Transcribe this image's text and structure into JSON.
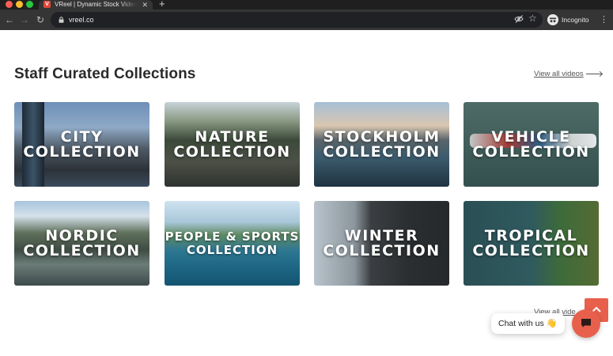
{
  "browser": {
    "tab_title": "VReel | Dynamic Stock Video &",
    "tab_close": "✕",
    "new_tab": "+",
    "url": "vreel.co",
    "incognito_label": "Incognito",
    "back_icon": "←",
    "forward_icon": "→",
    "reload_icon": "↻",
    "star_icon": "☆",
    "menu_icon": "⋮",
    "favicon_letter": "V"
  },
  "section": {
    "title": "Staff Curated Collections",
    "view_all_label": "View all videos",
    "view_all_bottom_label": "View all vide"
  },
  "collections": [
    {
      "label": "CITY\nCOLLECTION"
    },
    {
      "label": "NATURE\nCOLLECTION"
    },
    {
      "label": "STOCKHOLM\nCOLLECTION"
    },
    {
      "label": "VEHICLE\nCOLLECTION"
    },
    {
      "label": "NORDIC\nCOLLECTION"
    },
    {
      "label": "PEOPLE & SPORTS\nCOLLECTION"
    },
    {
      "label": "WINTER\nCOLLECTION"
    },
    {
      "label": "TROPICAL\nCOLLECTION"
    }
  ],
  "chat": {
    "bubble_text": "Chat with us",
    "wave": "👋"
  },
  "colors": {
    "accent": "#e8604c",
    "heading": "#2b2b2b"
  }
}
